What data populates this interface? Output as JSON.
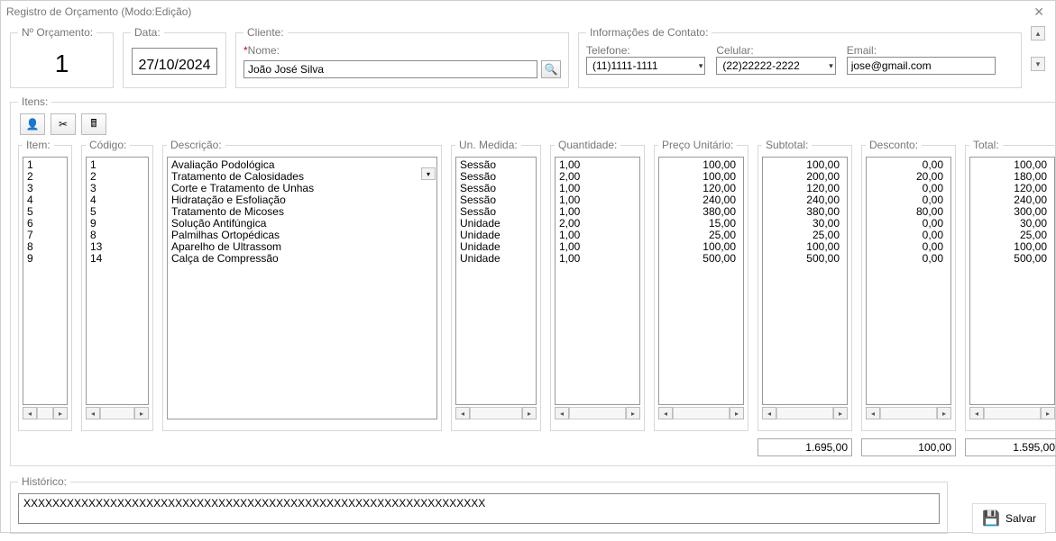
{
  "window": {
    "title": "Registro de Orçamento (Modo:Edição)"
  },
  "header": {
    "num_label": "Nº Orçamento:",
    "num_value": "1",
    "data_label": "Data:",
    "data_value": "27/10/2024"
  },
  "cliente": {
    "group": "Cliente:",
    "nome_label": "Nome:",
    "nome_value": "João José Silva"
  },
  "contato": {
    "group": "Informações de Contato:",
    "tel_label": "Telefone:",
    "tel_value": "(11)1111-1111",
    "cel_label": "Celular:",
    "cel_value": "(22)22222-2222",
    "email_label": "Email:",
    "email_value": "jose@gmail.com"
  },
  "itens": {
    "group": "Itens:",
    "cols": {
      "item": "Item:",
      "codigo": "Código:",
      "descricao": "Descrição:",
      "un": "Un. Medida:",
      "qtd": "Quantidade:",
      "pu": "Preço Unitário:",
      "sub": "Subtotal:",
      "desc": "Desconto:",
      "total": "Total:"
    },
    "rows": [
      {
        "item": "1",
        "codigo": "1",
        "desc": "Avaliação Podológica",
        "un": "Sessão",
        "qtd": "1,00",
        "pu": "100,00",
        "sub": "100,00",
        "d": "0,00",
        "t": "100,00"
      },
      {
        "item": "2",
        "codigo": "2",
        "desc": "Tratamento de Calosidades",
        "un": "Sessão",
        "qtd": "2,00",
        "pu": "100,00",
        "sub": "200,00",
        "d": "20,00",
        "t": "180,00"
      },
      {
        "item": "3",
        "codigo": "3",
        "desc": "Corte e Tratamento de Unhas",
        "un": "Sessão",
        "qtd": "1,00",
        "pu": "120,00",
        "sub": "120,00",
        "d": "0,00",
        "t": "120,00"
      },
      {
        "item": "4",
        "codigo": "4",
        "desc": "Hidratação e Esfoliação",
        "un": "Sessão",
        "qtd": "1,00",
        "pu": "240,00",
        "sub": "240,00",
        "d": "0,00",
        "t": "240,00"
      },
      {
        "item": "5",
        "codigo": "5",
        "desc": "Tratamento de Micoses",
        "un": "Sessão",
        "qtd": "1,00",
        "pu": "380,00",
        "sub": "380,00",
        "d": "80,00",
        "t": "300,00"
      },
      {
        "item": "6",
        "codigo": "9",
        "desc": "Solução Antifúngica",
        "un": "Unidade",
        "qtd": "2,00",
        "pu": "15,00",
        "sub": "30,00",
        "d": "0,00",
        "t": "30,00"
      },
      {
        "item": "7",
        "codigo": "8",
        "desc": "Palmilhas Ortopédicas",
        "un": "Unidade",
        "qtd": "1,00",
        "pu": "25,00",
        "sub": "25,00",
        "d": "0,00",
        "t": "25,00"
      },
      {
        "item": "8",
        "codigo": "13",
        "desc": "Aparelho de Ultrassom",
        "un": "Unidade",
        "qtd": "1,00",
        "pu": "100,00",
        "sub": "100,00",
        "d": "0,00",
        "t": "100,00"
      },
      {
        "item": "9",
        "codigo": "14",
        "desc": "Calça de Compressão",
        "un": "Unidade",
        "qtd": "1,00",
        "pu": "500,00",
        "sub": "500,00",
        "d": "0,00",
        "t": "500,00"
      }
    ],
    "totals": {
      "sub": "1.695,00",
      "desc": "100,00",
      "total": "1.595,00"
    }
  },
  "historico": {
    "label": "Histórico:",
    "value": "XXXXXXXXXXXXXXXXXXXXXXXXXXXXXXXXXXXXXXXXXXXXXXXXXXXXXXXXXXXXXXXX"
  },
  "save": {
    "label": "Salvar"
  },
  "icons": {
    "add_user": "👤",
    "tools": "✂",
    "calc": "🖩",
    "search": "🔍",
    "disk": "💾"
  }
}
